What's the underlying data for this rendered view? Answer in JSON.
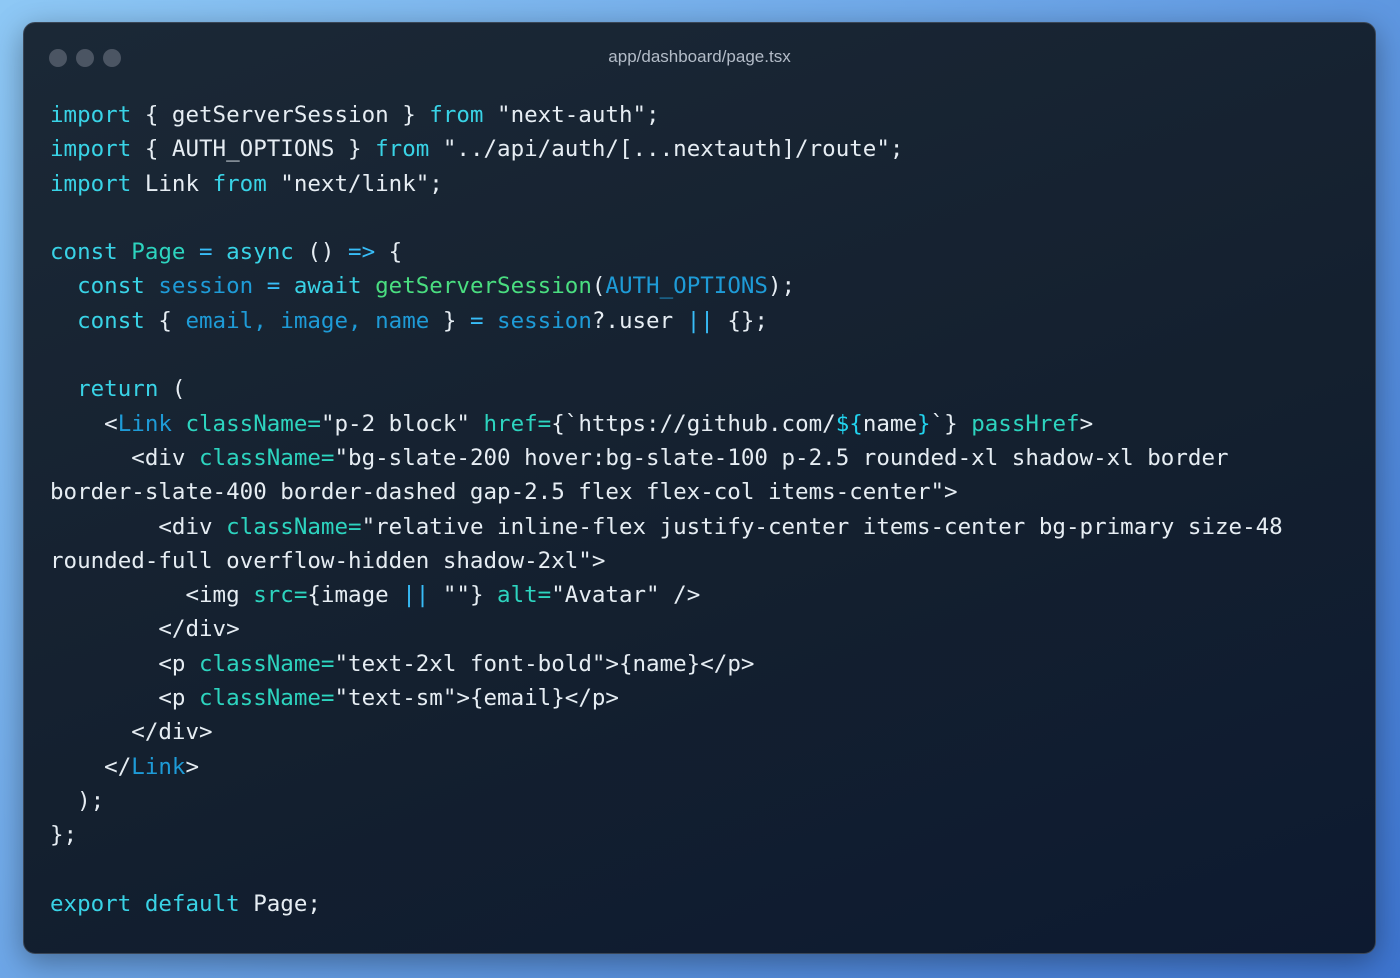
{
  "window": {
    "title": "app/dashboard/page.tsx"
  },
  "colors": {
    "keyword": "#39d3e6",
    "attribute": "#2dd4bf",
    "function": "#4ade80",
    "component": "#22d3ee",
    "variable": "#38bdf8",
    "plain": "#e6edf3",
    "background": "#14202f"
  },
  "code": {
    "lines": [
      [
        {
          "t": "import",
          "c": "kw"
        },
        {
          "t": " { getServerSession } ",
          "c": "pl"
        },
        {
          "t": "from",
          "c": "kw"
        },
        {
          "t": " \"next-auth\";",
          "c": "pl"
        }
      ],
      [
        {
          "t": "import",
          "c": "kw"
        },
        {
          "t": " { AUTH_OPTIONS } ",
          "c": "pl"
        },
        {
          "t": "from",
          "c": "kw"
        },
        {
          "t": " \"../api/auth/[...nextauth]/route\";",
          "c": "pl"
        }
      ],
      [
        {
          "t": "import",
          "c": "kw"
        },
        {
          "t": " Link ",
          "c": "pl"
        },
        {
          "t": "from",
          "c": "kw"
        },
        {
          "t": " \"next/link\";",
          "c": "pl"
        }
      ],
      [],
      [
        {
          "t": "const",
          "c": "kw"
        },
        {
          "t": " ",
          "c": "pl"
        },
        {
          "t": "Page",
          "c": "at"
        },
        {
          "t": " = ",
          "c": "op"
        },
        {
          "t": "async",
          "c": "kw"
        },
        {
          "t": " () ",
          "c": "pl"
        },
        {
          "t": "=>",
          "c": "op"
        },
        {
          "t": " {",
          "c": "pl"
        }
      ],
      [
        {
          "t": "  ",
          "c": "pl"
        },
        {
          "t": "const",
          "c": "kw"
        },
        {
          "t": " ",
          "c": "pl"
        },
        {
          "t": "session",
          "c": "dv"
        },
        {
          "t": " = ",
          "c": "op"
        },
        {
          "t": "await",
          "c": "kw"
        },
        {
          "t": " ",
          "c": "pl"
        },
        {
          "t": "getServerSession",
          "c": "fn"
        },
        {
          "t": "(",
          "c": "pl"
        },
        {
          "t": "AUTH_OPTIONS",
          "c": "dv"
        },
        {
          "t": ");",
          "c": "pl"
        }
      ],
      [
        {
          "t": "  ",
          "c": "pl"
        },
        {
          "t": "const",
          "c": "kw"
        },
        {
          "t": " { ",
          "c": "pl"
        },
        {
          "t": "email, image, name",
          "c": "dv"
        },
        {
          "t": " } ",
          "c": "pl"
        },
        {
          "t": "=",
          "c": "op"
        },
        {
          "t": " ",
          "c": "pl"
        },
        {
          "t": "session",
          "c": "dv"
        },
        {
          "t": "?.user ",
          "c": "pl"
        },
        {
          "t": "||",
          "c": "op"
        },
        {
          "t": " {};",
          "c": "pl"
        }
      ],
      [],
      [
        {
          "t": "  ",
          "c": "pl"
        },
        {
          "t": "return",
          "c": "kw"
        },
        {
          "t": " (",
          "c": "pl"
        }
      ],
      [
        {
          "t": "    <",
          "c": "pl"
        },
        {
          "t": "Link",
          "c": "dv"
        },
        {
          "t": " ",
          "c": "pl"
        },
        {
          "t": "className=",
          "c": "at"
        },
        {
          "t": "\"p-2 block\" ",
          "c": "pl"
        },
        {
          "t": "href=",
          "c": "at"
        },
        {
          "t": "{`https://github.com/",
          "c": "pl"
        },
        {
          "t": "${",
          "c": "cm"
        },
        {
          "t": "name",
          "c": "pl"
        },
        {
          "t": "}",
          "c": "cm"
        },
        {
          "t": "`} ",
          "c": "pl"
        },
        {
          "t": "passHref",
          "c": "at"
        },
        {
          "t": ">",
          "c": "pl"
        }
      ],
      [
        {
          "t": "      <div ",
          "c": "pl"
        },
        {
          "t": "className=",
          "c": "at"
        },
        {
          "t": "\"bg-slate-200 hover:bg-slate-100 p-2.5 rounded-xl shadow-xl border",
          "c": "pl"
        }
      ],
      [
        {
          "t": "border-slate-400 border-dashed gap-2.5 flex flex-col items-center\">",
          "c": "pl"
        }
      ],
      [
        {
          "t": "        <div ",
          "c": "pl"
        },
        {
          "t": "className=",
          "c": "at"
        },
        {
          "t": "\"relative inline-flex justify-center items-center bg-primary size-48",
          "c": "pl"
        }
      ],
      [
        {
          "t": "rounded-full overflow-hidden shadow-2xl\">",
          "c": "pl"
        }
      ],
      [
        {
          "t": "          <img ",
          "c": "pl"
        },
        {
          "t": "src=",
          "c": "at"
        },
        {
          "t": "{image ",
          "c": "pl"
        },
        {
          "t": "||",
          "c": "op"
        },
        {
          "t": " \"\"} ",
          "c": "pl"
        },
        {
          "t": "alt=",
          "c": "at"
        },
        {
          "t": "\"Avatar\" />",
          "c": "pl"
        }
      ],
      [
        {
          "t": "        </div>",
          "c": "pl"
        }
      ],
      [
        {
          "t": "        <p ",
          "c": "pl"
        },
        {
          "t": "className=",
          "c": "at"
        },
        {
          "t": "\"text-2xl font-bold\">{name}</p>",
          "c": "pl"
        }
      ],
      [
        {
          "t": "        <p ",
          "c": "pl"
        },
        {
          "t": "className=",
          "c": "at"
        },
        {
          "t": "\"text-sm\">{email}</p>",
          "c": "pl"
        }
      ],
      [
        {
          "t": "      </div>",
          "c": "pl"
        }
      ],
      [
        {
          "t": "    </",
          "c": "pl"
        },
        {
          "t": "Link",
          "c": "dv"
        },
        {
          "t": ">",
          "c": "pl"
        }
      ],
      [
        {
          "t": "  );",
          "c": "pl"
        }
      ],
      [
        {
          "t": "};",
          "c": "pl"
        }
      ],
      [],
      [
        {
          "t": "export",
          "c": "kw"
        },
        {
          "t": " ",
          "c": "pl"
        },
        {
          "t": "default",
          "c": "kw"
        },
        {
          "t": " Page;",
          "c": "pl"
        }
      ]
    ]
  }
}
